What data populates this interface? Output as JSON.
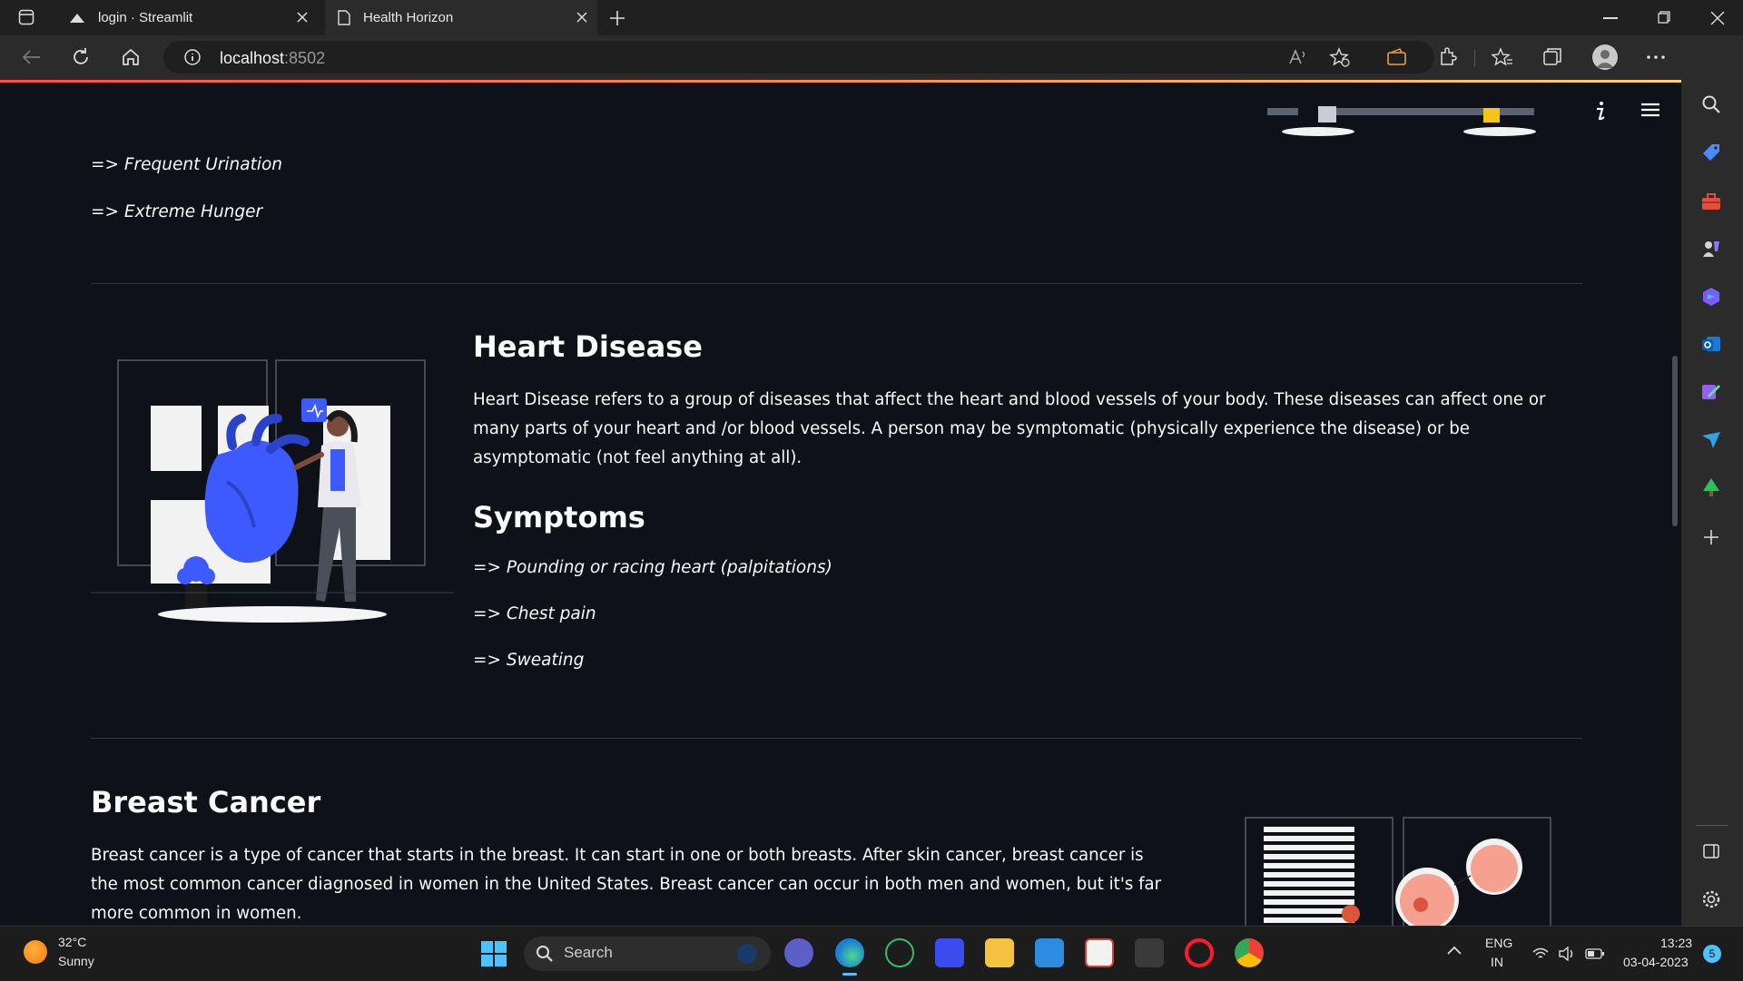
{
  "browser": {
    "tabs": [
      {
        "label": "login · Streamlit"
      },
      {
        "label": "Health Horizon"
      }
    ],
    "url": {
      "host": "localhost",
      "port": ":8502"
    }
  },
  "page": {
    "diabetes_symptoms": [
      "=> Frequent Urination",
      "=> Extreme Hunger"
    ],
    "heart": {
      "title": "Heart Disease",
      "description": "Heart Disease refers to a group of diseases that affect the heart and blood vessels of your body. These diseases can affect one or many parts of your heart and /or blood vessels. A person may be symptomatic (physically experience the disease) or be asymptomatic (not feel anything at all).",
      "symptoms_title": "Symptoms",
      "symptoms": [
        "=> Pounding or racing heart (palpitations)",
        "=> Chest pain",
        "=> Sweating"
      ]
    },
    "breast": {
      "title": "Breast Cancer",
      "description": "Breast cancer is a type of cancer that starts in the breast. It can start in one or both breasts. After skin cancer, breast cancer is the most common cancer diagnosed in women in the United States. Breast cancer can occur in both men and women, but it's far more common in women."
    }
  },
  "taskbar": {
    "weather_temp": "32°C",
    "weather_desc": "Sunny",
    "search_placeholder": "Search",
    "lang_top": "ENG",
    "lang_bottom": "IN",
    "time": "13:23",
    "date": "03-04-2023",
    "notification_count": "5"
  },
  "colors": {
    "app_bg": "#0e1117",
    "accent": "#ff4b4b",
    "illustration_blue": "#3d5afe"
  }
}
